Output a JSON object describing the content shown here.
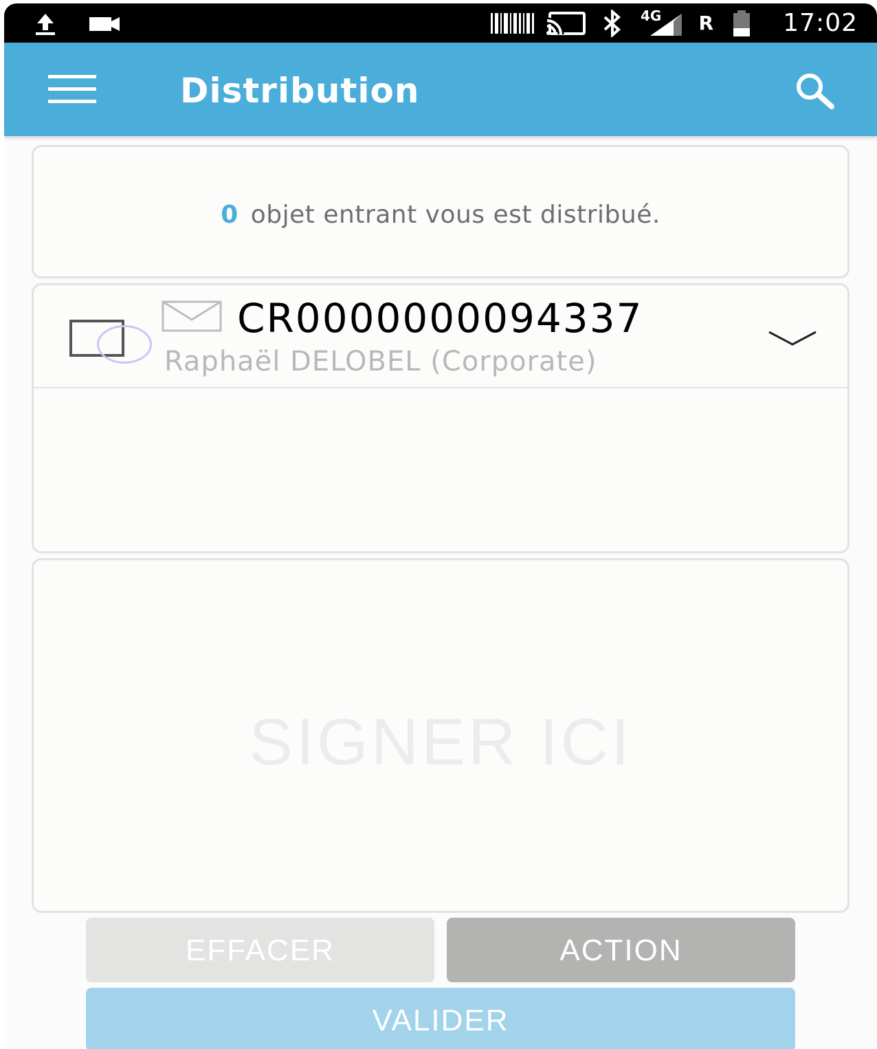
{
  "status_bar": {
    "time": "17:02",
    "network_type": "4G",
    "roaming": "R",
    "icons": [
      "upload-icon",
      "video-icon",
      "barcode-icon",
      "cast-icon",
      "bluetooth-icon",
      "signal-icon",
      "battery-icon"
    ]
  },
  "app_bar": {
    "title": "Distribution",
    "menu_icon": "hamburger-menu-icon",
    "search_icon": "search-icon",
    "color": "#4badd9"
  },
  "info": {
    "count": "0",
    "text": "objet entrant vous est distribué."
  },
  "item": {
    "code": "CR0000000094337",
    "sender": "Raphaël DELOBEL (Corporate)",
    "checked": false,
    "type_icon": "envelope-icon",
    "expand_icon": "chevron-down-icon"
  },
  "signature": {
    "placeholder": "SIGNER ICI"
  },
  "buttons": {
    "clear": "EFFACER",
    "action": "ACTION",
    "validate": "VALIDER"
  }
}
